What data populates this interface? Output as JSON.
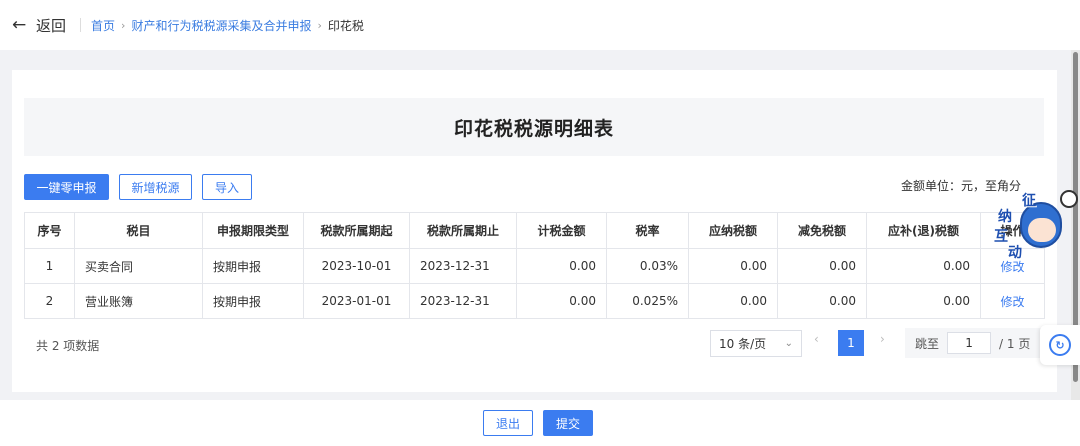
{
  "header": {
    "back_label": "返回",
    "breadcrumb": [
      "首页",
      "财产和行为税税源采集及合并申报",
      "印花税"
    ]
  },
  "main": {
    "title": "印花税税源明细表",
    "buttons": {
      "zero_declare": "一键零申报",
      "add_source": "新增税源",
      "import": "导入"
    },
    "unit_note": "金额单位：元，至角分",
    "table": {
      "columns": [
        "序号",
        "税目",
        "申报期限类型",
        "税款所属期起",
        "税款所属期止",
        "计税金额",
        "税率",
        "应纳税额",
        "减免税额",
        "应补(退)税额",
        "操作"
      ],
      "rows": [
        {
          "no": "1",
          "item": "买卖合同",
          "period_type": "按期申报",
          "start": "2023-10-01",
          "end": "2023-12-31",
          "taxable": "0.00",
          "rate": "0.03%",
          "payable": "0.00",
          "relief": "0.00",
          "due": "0.00",
          "action": "修改"
        },
        {
          "no": "2",
          "item": "营业账簿",
          "period_type": "按期申报",
          "start": "2023-01-01",
          "end": "2023-12-31",
          "taxable": "0.00",
          "rate": "0.025%",
          "payable": "0.00",
          "relief": "0.00",
          "due": "0.00",
          "action": "修改"
        }
      ]
    },
    "pagination": {
      "total_text": "共 2 项数据",
      "page_size": "10 条/页",
      "current_page": "1",
      "jump_label": "跳至",
      "jump_value": "1",
      "total_pages": "/ 1 页",
      "prev_icon": "chevron-left",
      "next_icon": "chevron-right"
    }
  },
  "footer": {
    "exit_label": "退出",
    "submit_label": "提交"
  },
  "floating": {
    "mascot_text": [
      "征",
      "纳",
      "互",
      "动"
    ]
  },
  "colors": {
    "primary": "#3b7cf0",
    "page_bg": "#f1f2f5"
  }
}
